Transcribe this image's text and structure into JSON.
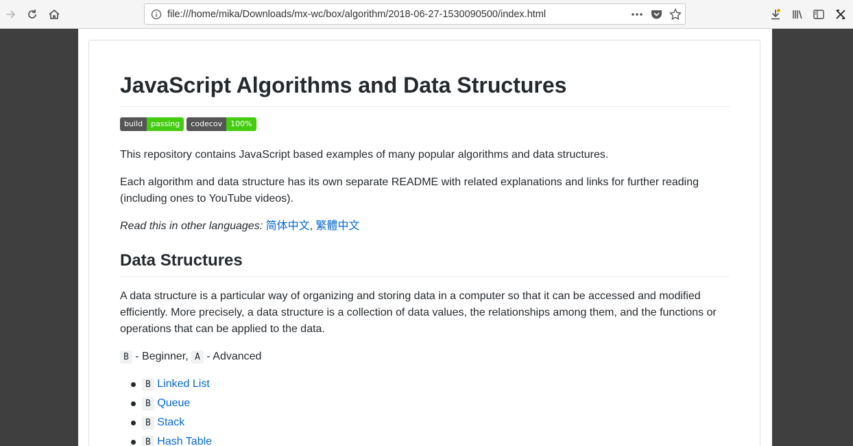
{
  "browser": {
    "url": "file:///home/mika/Downloads/mx-wc/box/algorithm/2018-06-27-1530090500/index.html",
    "icons": [
      "forward-icon",
      "reload-icon",
      "home-icon",
      "info-icon",
      "more-icon",
      "pocket-icon",
      "bookmark-star-icon",
      "downloads-icon",
      "library-icon",
      "sidebar-icon",
      "extension-icon"
    ]
  },
  "page": {
    "title": "JavaScript Algorithms and Data Structures",
    "badges": [
      {
        "left": "build",
        "right": "passing",
        "color": "#44cc11"
      },
      {
        "left": "codecov",
        "right": "100%",
        "color": "#44cc11"
      }
    ],
    "intro": "This repository contains JavaScript based examples of many popular algorithms and data structures.",
    "intro2": "Each algorithm and data structure has its own separate README with related explanations and links for further reading (including ones to YouTube videos).",
    "languages_label": "Read this in other languages:",
    "lang_links": [
      "简体中文",
      "繁體中文"
    ],
    "lang_sep": ",",
    "section_title": "Data Structures",
    "section_desc": "A data structure is a particular way of organizing and storing data in a computer so that it can be accessed and modified efficiently. More precisely, a data structure is a collection of data values, the relationships among them, and the functions or operations that can be applied to the data.",
    "legend": {
      "b": "B",
      "b_text": " - Beginner, ",
      "a": "A",
      "a_text": " - Advanced"
    },
    "items": [
      {
        "level": "B",
        "label": "Linked List"
      },
      {
        "level": "B",
        "label": "Queue"
      },
      {
        "level": "B",
        "label": "Stack"
      },
      {
        "level": "B",
        "label": "Hash Table"
      }
    ],
    "link_color": "#0366d6"
  }
}
